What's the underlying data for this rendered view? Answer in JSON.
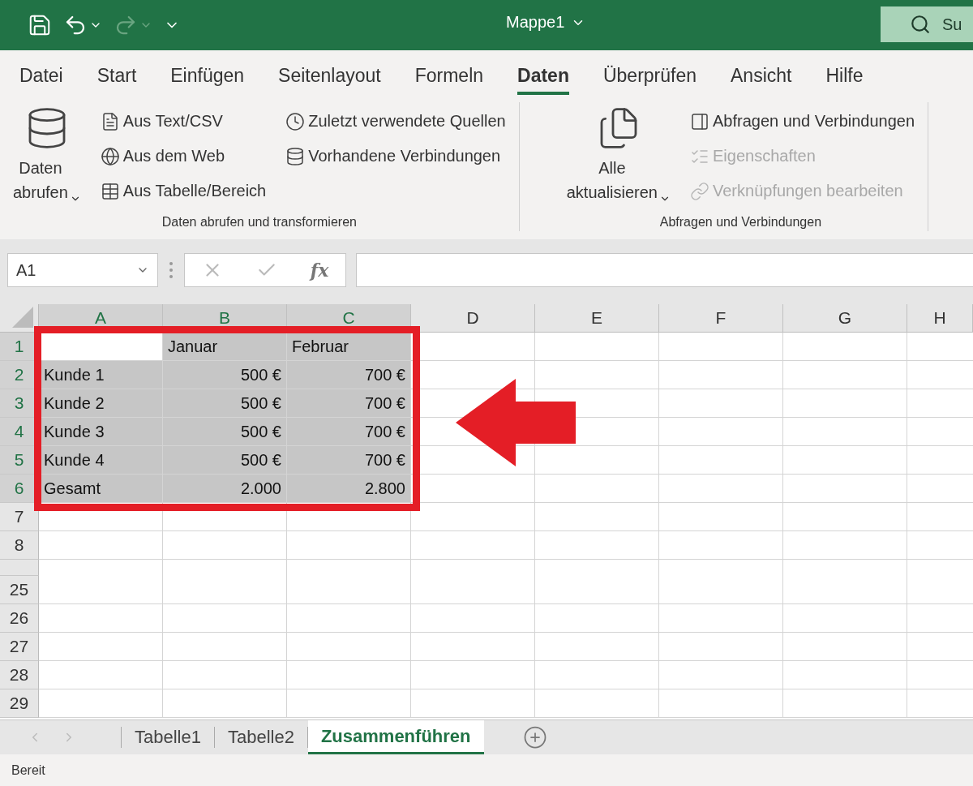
{
  "title_bar": {
    "title": "Mappe1",
    "search": {
      "value": "Su"
    },
    "redo_disabled": true
  },
  "menu_tabs": [
    {
      "label": "Datei",
      "selected": false
    },
    {
      "label": "Start",
      "selected": false
    },
    {
      "label": "Einfügen",
      "selected": false
    },
    {
      "label": "Seitenlayout",
      "selected": false
    },
    {
      "label": "Formeln",
      "selected": false
    },
    {
      "label": "Daten",
      "selected": true
    },
    {
      "label": "Überprüfen",
      "selected": false
    },
    {
      "label": "Ansicht",
      "selected": false
    },
    {
      "label": "Hilfe",
      "selected": false
    }
  ],
  "ribbon": {
    "groups": [
      {
        "label": "Daten abrufen und transformieren",
        "big_button": "Daten abrufen",
        "columns": [
          [
            {
              "label": "Aus Text/CSV",
              "disabled": false
            },
            {
              "label": "Aus dem Web",
              "disabled": false
            },
            {
              "label": "Aus Tabelle/Bereich",
              "disabled": false
            }
          ],
          [
            {
              "label": "Zuletzt verwendete Quellen",
              "disabled": false
            },
            {
              "label": "Vorhandene Verbindungen",
              "disabled": false
            }
          ]
        ]
      },
      {
        "label": "Abfragen und Verbindungen",
        "big_button": "Alle aktualisieren",
        "columns": [
          [
            {
              "label": "Abfragen und Verbindungen",
              "disabled": false
            },
            {
              "label": "Eigenschaften",
              "disabled": true
            },
            {
              "label": "Verknüpfungen bearbeiten",
              "disabled": true
            }
          ]
        ]
      }
    ]
  },
  "formula_bar": {
    "name_box": "A1",
    "function_label": "fx"
  },
  "sheet": {
    "columns": [
      {
        "label": "A",
        "selected": true
      },
      {
        "label": "B",
        "selected": true
      },
      {
        "label": "C",
        "selected": true
      },
      {
        "label": "D",
        "selected": false
      },
      {
        "label": "E",
        "selected": false
      },
      {
        "label": "F",
        "selected": false
      },
      {
        "label": "G",
        "selected": false
      },
      {
        "label": "H",
        "selected": false
      }
    ],
    "rows": [
      {
        "number": "1",
        "selected": true,
        "cells": [
          {
            "selected": false
          },
          {
            "text": "Januar",
            "kind": "text",
            "selected": true
          },
          {
            "text": "Februar",
            "kind": "text",
            "selected": true
          }
        ]
      },
      {
        "number": "2",
        "selected": true,
        "cells": [
          {
            "text": "Kunde 1",
            "kind": "text",
            "selected": true
          },
          {
            "text": "500 €",
            "kind": "number",
            "selected": true
          },
          {
            "text": "700 €",
            "kind": "number",
            "selected": true
          }
        ]
      },
      {
        "number": "3",
        "selected": true,
        "cells": [
          {
            "text": "Kunde 2",
            "kind": "text",
            "selected": true
          },
          {
            "text": "500 €",
            "kind": "number",
            "selected": true
          },
          {
            "text": "700 €",
            "kind": "number",
            "selected": true
          }
        ]
      },
      {
        "number": "4",
        "selected": true,
        "cells": [
          {
            "text": "Kunde 3",
            "kind": "text",
            "selected": true
          },
          {
            "text": "500 €",
            "kind": "number",
            "selected": true
          },
          {
            "text": "700 €",
            "kind": "number",
            "selected": true
          }
        ]
      },
      {
        "number": "5",
        "selected": true,
        "cells": [
          {
            "text": "Kunde 4",
            "kind": "text",
            "selected": true
          },
          {
            "text": "500 €",
            "kind": "number",
            "selected": true
          },
          {
            "text": "700 €",
            "kind": "number",
            "selected": true
          }
        ]
      },
      {
        "number": "6",
        "selected": true,
        "cells": [
          {
            "text": "Gesamt",
            "kind": "text",
            "selected": true
          },
          {
            "text": "2.000",
            "kind": "number",
            "selected": true
          },
          {
            "text": "2.800",
            "kind": "number",
            "selected": true
          }
        ]
      },
      {
        "number": "7",
        "selected": false,
        "cells": []
      },
      {
        "number": "8",
        "selected": false,
        "cells": []
      },
      {
        "selected": false,
        "cells": []
      },
      {
        "number": "25",
        "selected": false,
        "cells": []
      },
      {
        "number": "26",
        "selected": false,
        "cells": []
      },
      {
        "number": "27",
        "selected": false,
        "cells": []
      },
      {
        "number": "28",
        "selected": false,
        "cells": []
      },
      {
        "number": "29",
        "selected": false,
        "cells": []
      }
    ]
  },
  "sheet_tabs": [
    {
      "label": "Tabelle1",
      "selected": false
    },
    {
      "label": "Tabelle2",
      "selected": false
    },
    {
      "label": "Zusammenführen",
      "selected": true
    }
  ],
  "status_bar": {
    "text": "Bereit"
  }
}
